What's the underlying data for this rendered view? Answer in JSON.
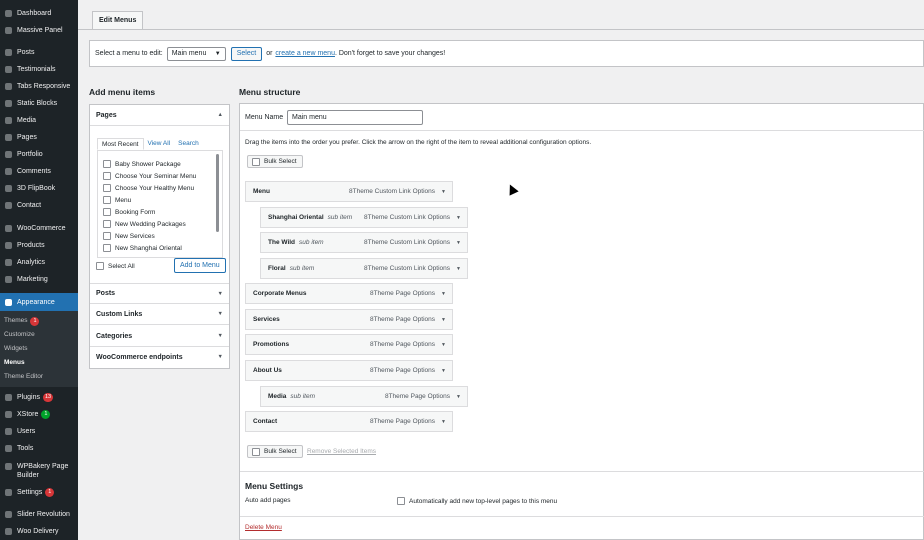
{
  "sidebar": {
    "items": [
      {
        "label": "Dashboard",
        "icon": "dashboard-icon"
      },
      {
        "label": "Massive Panel",
        "icon": "panel-icon"
      },
      {
        "label": "Posts",
        "icon": "pin-icon"
      },
      {
        "label": "Testimonials",
        "icon": "quote-icon"
      },
      {
        "label": "Tabs Responsive",
        "icon": "tabs-icon"
      },
      {
        "label": "Static Blocks",
        "icon": "blocks-icon"
      },
      {
        "label": "Media",
        "icon": "media-icon"
      },
      {
        "label": "Pages",
        "icon": "pages-icon"
      },
      {
        "label": "Portfolio",
        "icon": "portfolio-icon"
      },
      {
        "label": "Comments",
        "icon": "comment-icon"
      },
      {
        "label": "3D FlipBook",
        "icon": "book-icon"
      },
      {
        "label": "Contact",
        "icon": "mail-icon"
      },
      {
        "label": "WooCommerce",
        "icon": "woocommerce-icon"
      },
      {
        "label": "Products",
        "icon": "products-icon"
      },
      {
        "label": "Analytics",
        "icon": "analytics-icon"
      },
      {
        "label": "Marketing",
        "icon": "megaphone-icon"
      },
      {
        "label": "Appearance",
        "icon": "brush-icon"
      }
    ],
    "appearance_sub": {
      "themes": "Themes",
      "themes_badge": "1",
      "customize": "Customize",
      "widgets": "Widgets",
      "menus": "Menus",
      "theme_editor": "Theme Editor"
    },
    "items_after": [
      {
        "label": "Plugins",
        "icon": "plugin-icon",
        "badge": "13"
      },
      {
        "label": "XStore",
        "icon": "xstore-icon",
        "badge": "1"
      },
      {
        "label": "Users",
        "icon": "users-icon"
      },
      {
        "label": "Tools",
        "icon": "tools-icon"
      },
      {
        "label": "WPBakery Page Builder",
        "icon": "wpbakery-icon"
      },
      {
        "label": "Settings",
        "icon": "settings-icon",
        "badge": "1"
      },
      {
        "label": "Slider Revolution",
        "icon": "slider-icon"
      },
      {
        "label": "Woo Delivery",
        "icon": "delivery-icon"
      }
    ]
  },
  "tab": {
    "label": "Edit Menus"
  },
  "select_bar": {
    "prefix": "Select a menu to edit:",
    "selected_menu": "Main menu",
    "select_button": "Select",
    "or_text": "or",
    "create_link": "create a new menu",
    "suffix": ". Don't forget to save your changes!"
  },
  "add_items": {
    "title": "Add menu items",
    "pages_header": "Pages",
    "tabs": [
      "Most Recent",
      "View All",
      "Search"
    ],
    "pages": [
      "Baby Shower Package",
      "Choose Your Seminar Menu",
      "Choose Your Healthy Menu",
      "Menu",
      "Booking Form",
      "New Wedding Packages",
      "New Services",
      "New Shanghai Oriental"
    ],
    "select_all": "Select All",
    "add_button": "Add to Menu",
    "sections": [
      "Posts",
      "Custom Links",
      "Categories",
      "WooCommerce endpoints"
    ]
  },
  "structure": {
    "title": "Menu structure",
    "menu_name_label": "Menu Name",
    "menu_name_value": "Main menu",
    "instructions": "Drag the items into the order you prefer. Click the arrow on the right of the item to reveal additional configuration options.",
    "bulk_select": "Bulk Select",
    "remove_selected": "Remove Selected Items",
    "items": [
      {
        "title": "Menu",
        "sub": "",
        "type": "8Theme Custom Link Options"
      },
      {
        "title": "Shanghai Oriental",
        "sub": "sub item",
        "type": "8Theme Custom Link Options"
      },
      {
        "title": "The Wild",
        "sub": "sub item",
        "type": "8Theme Custom Link Options"
      },
      {
        "title": "Floral",
        "sub": "sub item",
        "type": "8Theme Custom Link Options"
      },
      {
        "title": "Corporate Menus",
        "sub": "",
        "type": "8Theme Page Options"
      },
      {
        "title": "Services",
        "sub": "",
        "type": "8Theme Page Options"
      },
      {
        "title": "Promotions",
        "sub": "",
        "type": "8Theme Page Options"
      },
      {
        "title": "About Us",
        "sub": "",
        "type": "8Theme Page Options"
      },
      {
        "title": "Media",
        "sub": "sub item",
        "type": "8Theme Page Options"
      },
      {
        "title": "Contact",
        "sub": "",
        "type": "8Theme Page Options"
      }
    ],
    "settings_title": "Menu Settings",
    "auto_add_label": "Auto add pages",
    "auto_add_option": "Automatically add new top-level pages to this menu",
    "delete_link": "Delete Menu"
  }
}
